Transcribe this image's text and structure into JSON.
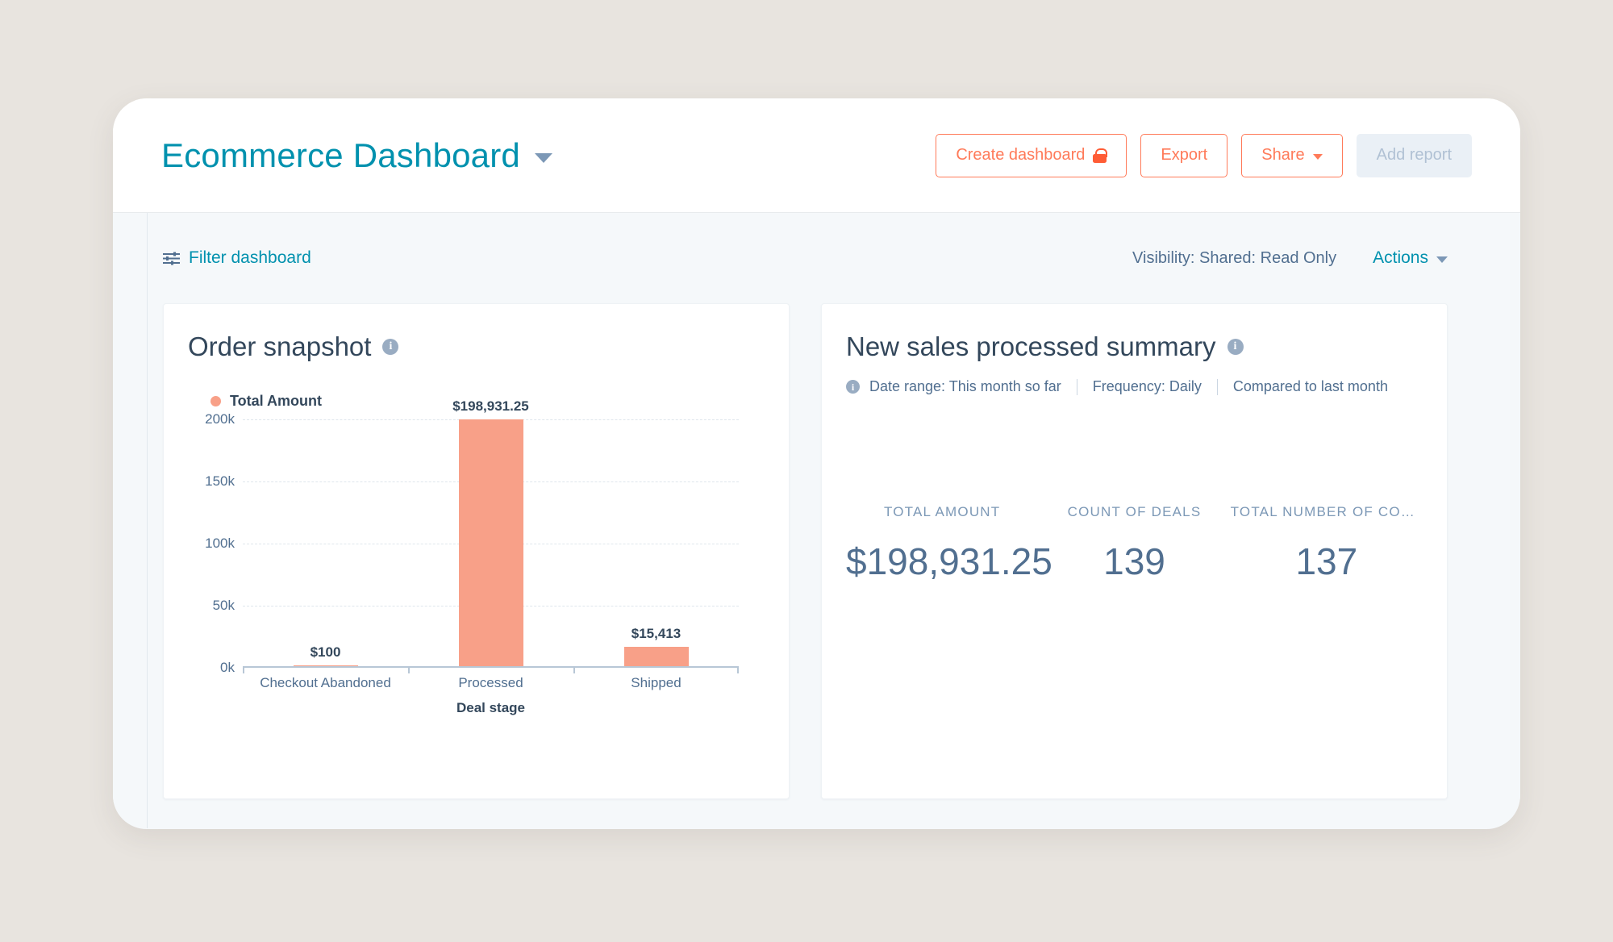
{
  "header": {
    "dashboard_title": "Ecommerce Dashboard",
    "buttons": {
      "create_dashboard": "Create dashboard",
      "export": "Export",
      "share": "Share",
      "add_report": "Add report"
    }
  },
  "toolbar": {
    "filter_label": "Filter dashboard",
    "visibility_text": "Visibility:  Shared: Read Only",
    "actions_label": "Actions"
  },
  "cards": {
    "order_snapshot": {
      "title": "Order snapshot",
      "legend_label": "Total Amount",
      "axis_title": "Deal stage"
    },
    "new_sales": {
      "title": "New sales processed summary",
      "date_range": "Date range: This month so far",
      "frequency": "Frequency: Daily",
      "comparison": "Compared to last month",
      "kpis": [
        {
          "label": "TOTAL AMOUNT",
          "value": "$198,931.25"
        },
        {
          "label": "COUNT OF DEALS",
          "value": "139"
        },
        {
          "label": "TOTAL NUMBER OF CONTA...",
          "value": "137"
        }
      ]
    }
  },
  "chart_data": {
    "type": "bar",
    "title": "Order snapshot",
    "xlabel": "Deal stage",
    "ylabel": "",
    "categories": [
      "Checkout Abandoned",
      "Processed",
      "Shipped"
    ],
    "values": [
      100,
      198931.25,
      15413
    ],
    "value_labels": [
      "$100",
      "$198,931.25",
      "$15,413"
    ],
    "series": [
      {
        "name": "Total Amount",
        "color": "#f8a088",
        "values": [
          100,
          198931.25,
          15413
        ]
      }
    ],
    "ylim": [
      0,
      200000
    ],
    "yticks": [
      0,
      50000,
      100000,
      150000,
      200000
    ],
    "ytick_labels": [
      "0k",
      "50k",
      "100k",
      "150k",
      "200k"
    ],
    "grid": true,
    "legend_position": "top-left"
  },
  "colors": {
    "page_background": "#e8e4df",
    "app_background": "#f5f8fa",
    "accent_teal": "#0091ae",
    "accent_orange": "#ff7a59",
    "bar_salmon": "#f8a088",
    "text_dark": "#33475b",
    "text_muted": "#516f90"
  }
}
